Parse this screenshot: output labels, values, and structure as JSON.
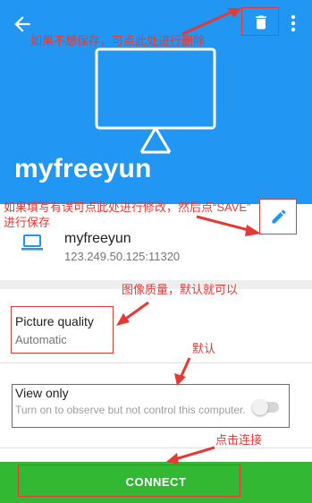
{
  "header": {
    "title": "myfreeyun",
    "back_icon": "arrow-back-icon",
    "delete_icon": "trash-icon",
    "more_icon": "more-vert-icon",
    "monitor_icon": "monitor-icon",
    "color": "#2196f3"
  },
  "server": {
    "name": "myfreeyun",
    "address": "123.249.50.125:11320",
    "icon": "laptop-icon",
    "edit_icon": "edit-pencil-icon"
  },
  "settings": {
    "picture_quality": {
      "label": "Picture quality",
      "value": "Automatic"
    },
    "view_only": {
      "label": "View only",
      "description": "Turn on to observe but not control this computer.",
      "enabled": false
    }
  },
  "connect": {
    "label": "CONNECT",
    "color": "#32b832"
  },
  "annotations": {
    "delete": "如果不想保存，可点此处进行删除",
    "edit_line1": "如果填写有误可点此处进行修改，然后点“SAVE”",
    "edit_line2": "进行保存",
    "quality": "图像质量，默认就可以",
    "default": "默认",
    "connect": "点击连接",
    "color": "#e53935"
  }
}
